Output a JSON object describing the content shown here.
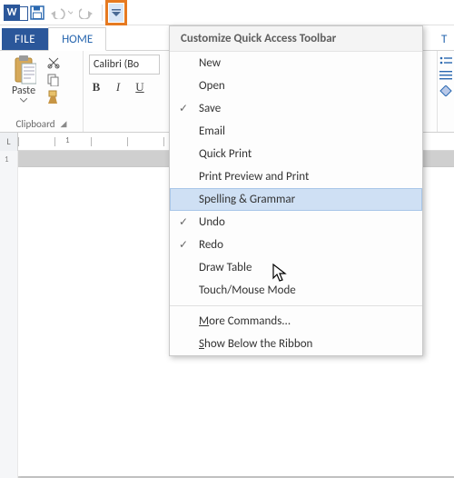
{
  "qat": {
    "word_letter": "W"
  },
  "tabs": {
    "file": "FILE",
    "home": "HOME",
    "partial": "T"
  },
  "ribbon": {
    "paste_label": "Paste",
    "clipboard_group": "Clipboard",
    "font_name": "Calibri (Bo",
    "bold": "B",
    "italic": "I",
    "underline": "U"
  },
  "ruler": {
    "left_mark": "L",
    "num1": "1"
  },
  "menu": {
    "title": "Customize Quick Access Toolbar",
    "items": [
      {
        "label": "New",
        "checked": false
      },
      {
        "label": "Open",
        "checked": false
      },
      {
        "label": "Save",
        "checked": true
      },
      {
        "label": "Email",
        "checked": false
      },
      {
        "label": "Quick Print",
        "checked": false
      },
      {
        "label": "Print Preview and Print",
        "checked": false
      },
      {
        "label": "Spelling & Grammar",
        "checked": false,
        "hovered": true
      },
      {
        "label": "Undo",
        "checked": true
      },
      {
        "label": "Redo",
        "checked": true
      },
      {
        "label": "Draw Table",
        "checked": false
      },
      {
        "label": "Touch/Mouse Mode",
        "checked": false
      }
    ],
    "more_pre": "M",
    "more_post": "ore Commands...",
    "show_pre": "S",
    "show_post": "how Below the Ribbon"
  }
}
